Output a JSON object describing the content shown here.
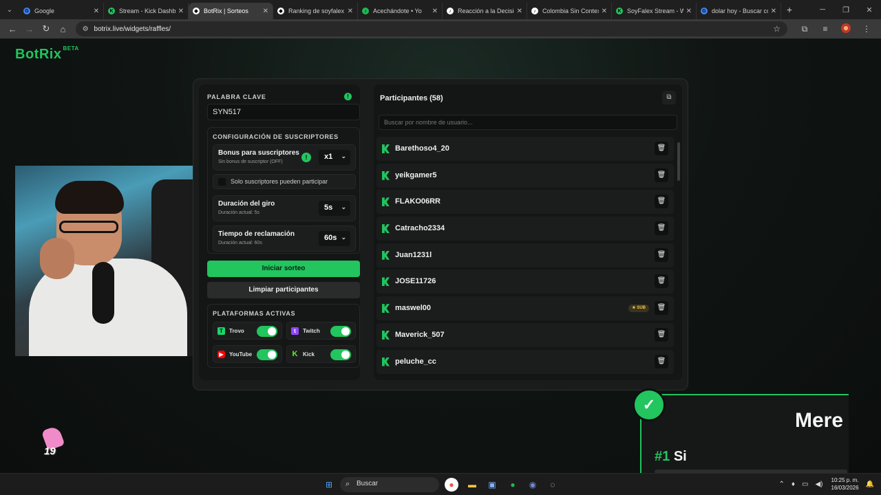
{
  "browser": {
    "tabs": [
      {
        "title": "Google",
        "color": "#4285f4",
        "glyph": "G"
      },
      {
        "title": "Stream - Kick Dashbo",
        "color": "#22c55e",
        "glyph": "K"
      },
      {
        "title": "BotRix | Sorteos",
        "color": "#ffffff",
        "glyph": "◆",
        "active": true
      },
      {
        "title": "Ranking de soyfalex",
        "color": "#ffffff",
        "glyph": "◆"
      },
      {
        "title": "Acechándote • Yo",
        "color": "#1db954",
        "glyph": "♪"
      },
      {
        "title": "Reacción a la Decisió",
        "color": "#ffffff",
        "glyph": "♪"
      },
      {
        "title": "Colombia Sin Contex",
        "color": "#ffffff",
        "glyph": "♪"
      },
      {
        "title": "SoyFalex Stream - W",
        "color": "#22c55e",
        "glyph": "K"
      },
      {
        "title": "dolar hoy - Buscar co",
        "color": "#4285f4",
        "glyph": "G"
      }
    ],
    "url": "botrix.live/widgets/raffles/"
  },
  "app": {
    "logo": "BotRix",
    "logo_badge": "BETA",
    "accent": "#22c55e"
  },
  "raffle": {
    "keyword_label": "PALABRA CLAVE",
    "keyword_value": "SYN517",
    "sub_config_label": "CONFIGURACIÓN DE SUSCRIPTORES",
    "bonus_title": "Bonus para suscriptores",
    "bonus_sub": "Sin bonus de suscriptor (OFF)",
    "bonus_value": "x1",
    "subs_only_label": "Solo suscriptores pueden participar",
    "spin_title": "Duración del giro",
    "spin_sub": "Duración actual: 5s",
    "spin_value": "5s",
    "claim_title": "Tiempo de reclamación",
    "claim_sub": "Duración actual: 60s",
    "claim_value": "60s",
    "start_button": "Iniciar sorteo",
    "clear_button": "Limpiar participantes",
    "platforms_label": "PLATAFORMAS ACTIVAS",
    "platforms": [
      {
        "name": "Trovo",
        "color": "#19d66b",
        "enabled": true
      },
      {
        "name": "Twitch",
        "color": "#9146ff",
        "enabled": true
      },
      {
        "name": "YouTube",
        "color": "#ff0000",
        "enabled": true
      },
      {
        "name": "Kick",
        "color": "#53fc18",
        "enabled": true
      }
    ]
  },
  "participants": {
    "title": "Participantes (58)",
    "search_placeholder": "Buscar por nombre de usuario...",
    "sub_badge": "★ SUB",
    "rows": [
      {
        "name": "Barethoso4_20",
        "sub": false
      },
      {
        "name": "yeikgamer5",
        "sub": false
      },
      {
        "name": "FLAKO06RR",
        "sub": false
      },
      {
        "name": "Catracho2334",
        "sub": false
      },
      {
        "name": "Juan1231l",
        "sub": false
      },
      {
        "name": "JOSE11726",
        "sub": false
      },
      {
        "name": "maswel00",
        "sub": true
      },
      {
        "name": "Maverick_507",
        "sub": false
      },
      {
        "name": "peluche_cc",
        "sub": false
      }
    ]
  },
  "overlay": {
    "headline": "Mere",
    "rank": "#1",
    "rank_text": "Si",
    "sticker_number": "19"
  },
  "taskbar": {
    "search": "Buscar",
    "time": "10:25 p. m.",
    "date": "16/03/2026"
  }
}
